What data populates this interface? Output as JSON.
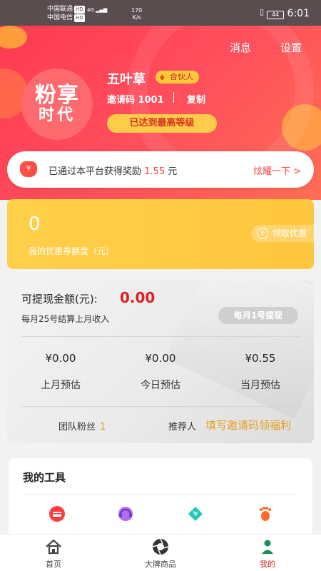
{
  "status_bar": {
    "carrier1": "中国联通",
    "carrier2": "中国电信",
    "hd": "HD",
    "net1": "4G",
    "net2": "4G",
    "speed_value": "170",
    "speed_unit": "K/s",
    "battery": "44",
    "time": "6:01"
  },
  "header": {
    "messages_label": "消息",
    "settings_label": "设置",
    "logo_line1": "粉享",
    "logo_line2": "时代",
    "nickname": "五叶草",
    "badge_label": "合伙人",
    "invite_label": "邀请码 1001",
    "copy_label": "复制",
    "level_label": "已达到最高等级"
  },
  "reward": {
    "text_prefix": "已通过本平台获得奖励",
    "amount": "1.55",
    "unit": "元",
    "link_label": "炫耀一下 >"
  },
  "coupon": {
    "amount": "0",
    "label": "我的优惠券额度（元）",
    "button_label": "领取优惠",
    "button_icon": "¥"
  },
  "withdraw": {
    "label": "可提现金额(元):",
    "amount": "0.00",
    "note": "每月25号结算上月收入",
    "button_label": "每月1号提现",
    "stats": [
      {
        "value": "¥0.00",
        "label": "上月预估"
      },
      {
        "value": "¥0.00",
        "label": "今日预估"
      },
      {
        "value": "¥0.55",
        "label": "当月预估"
      }
    ],
    "team_label": "团队粉丝",
    "team_count": "1",
    "referrer_label": "推荐人",
    "referrer_link": "填写邀请码领福利"
  },
  "tools": {
    "title": "我的工具"
  },
  "nav": {
    "items": [
      {
        "label": "首页",
        "icon": "home-icon"
      },
      {
        "label": "大牌商品",
        "icon": "shutter-icon"
      },
      {
        "label": "我的",
        "icon": "person-icon"
      }
    ]
  },
  "colors": {
    "header_red": "#ff4e5c",
    "coupon_yellow": "#ffc63f",
    "accent_red": "#e02020",
    "accent_gold": "#e5a020"
  }
}
